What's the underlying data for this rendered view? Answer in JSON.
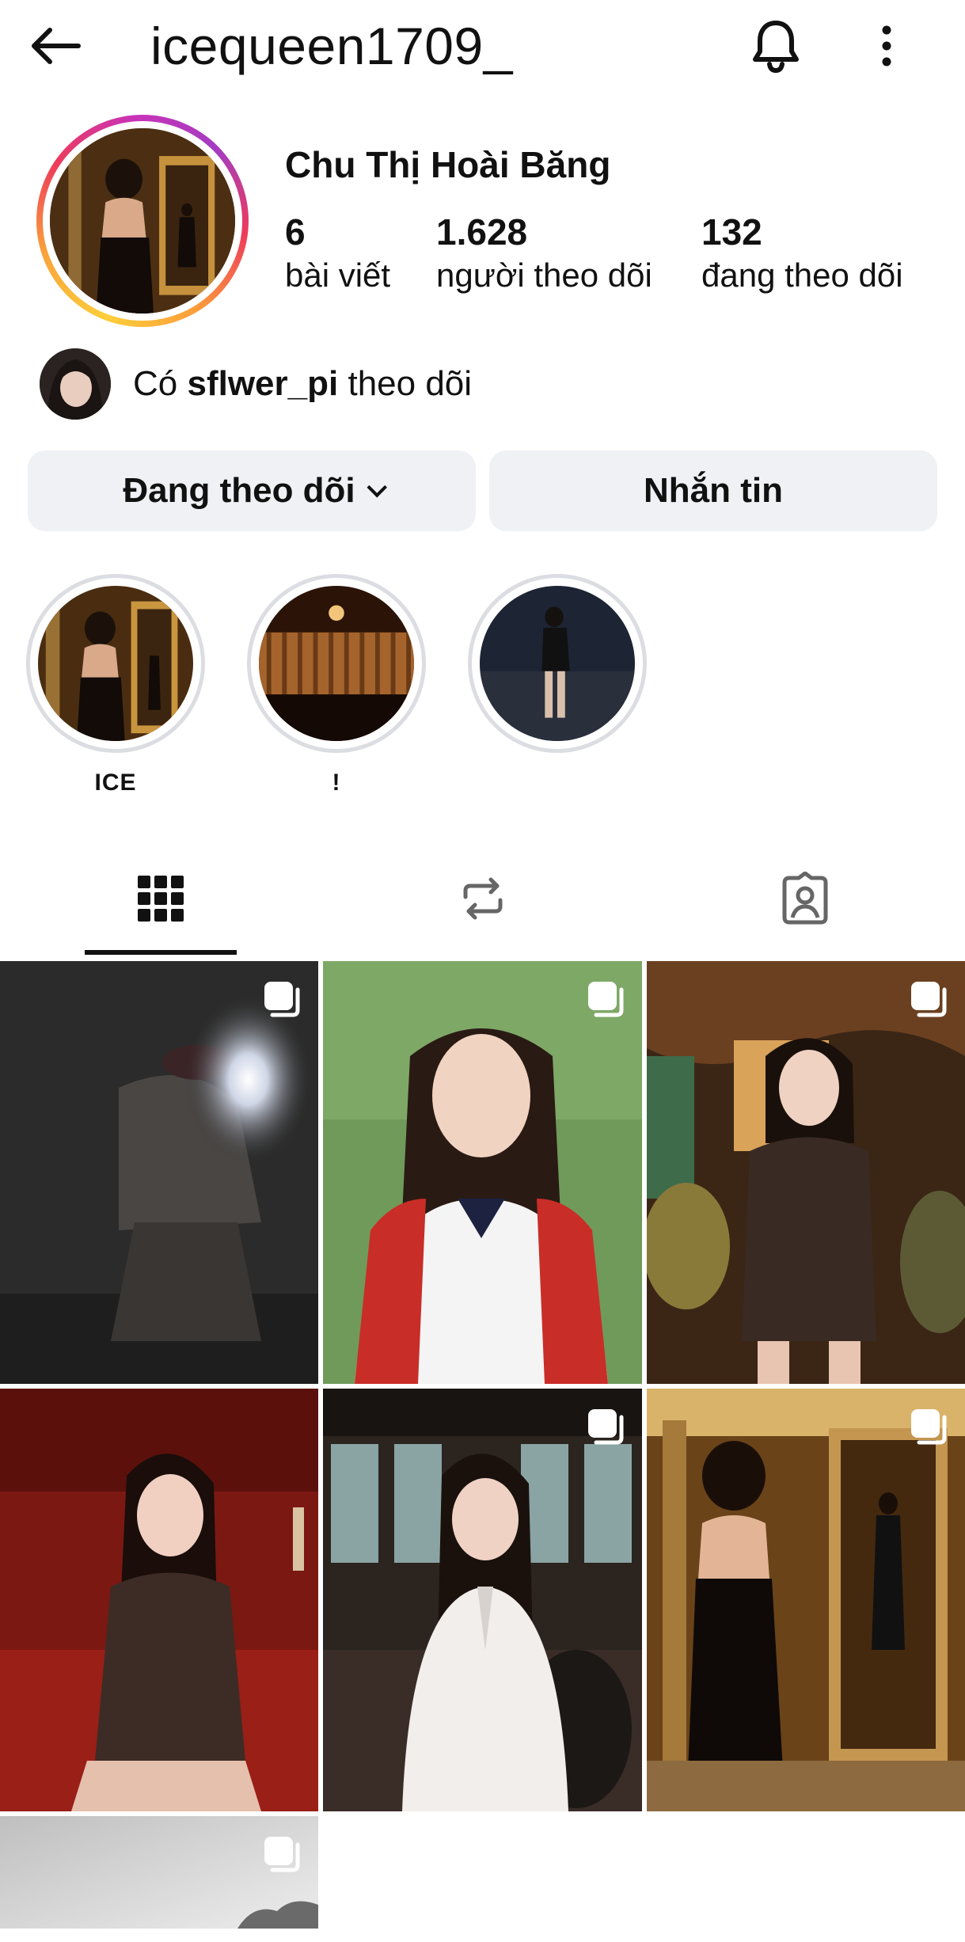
{
  "header": {
    "back_icon": "arrow-left-icon",
    "username": "icequeen1709_",
    "bell_icon": "bell-icon",
    "more_icon": "more-vertical-icon"
  },
  "profile": {
    "display_name": "Chu Thị Hoài Băng",
    "stats": [
      {
        "value": "6",
        "label": "bài viết"
      },
      {
        "value": "1.628",
        "label": "người theo dõi"
      },
      {
        "value": "132",
        "label": "đang theo dõi"
      }
    ],
    "followed_by": {
      "prefix": "Có",
      "user": "sflwer_pi",
      "suffix": "theo dõi"
    }
  },
  "actions": {
    "following_label": "Đang theo dõi",
    "message_label": "Nhắn tin"
  },
  "highlights": [
    {
      "label": "ICE"
    },
    {
      "label": "!"
    },
    {
      "label": ""
    }
  ],
  "tabs": [
    {
      "icon": "grid-icon",
      "active": true
    },
    {
      "icon": "reposts-icon",
      "active": false
    },
    {
      "icon": "tagged-icon",
      "active": false
    }
  ],
  "posts_count": 7,
  "colors": {
    "button_bg": "#eff1f5",
    "text": "#111111",
    "highlight_ring": "#dcdde2",
    "story_ring_start": "#fdcf3a",
    "story_ring_end": "#c933b6"
  }
}
